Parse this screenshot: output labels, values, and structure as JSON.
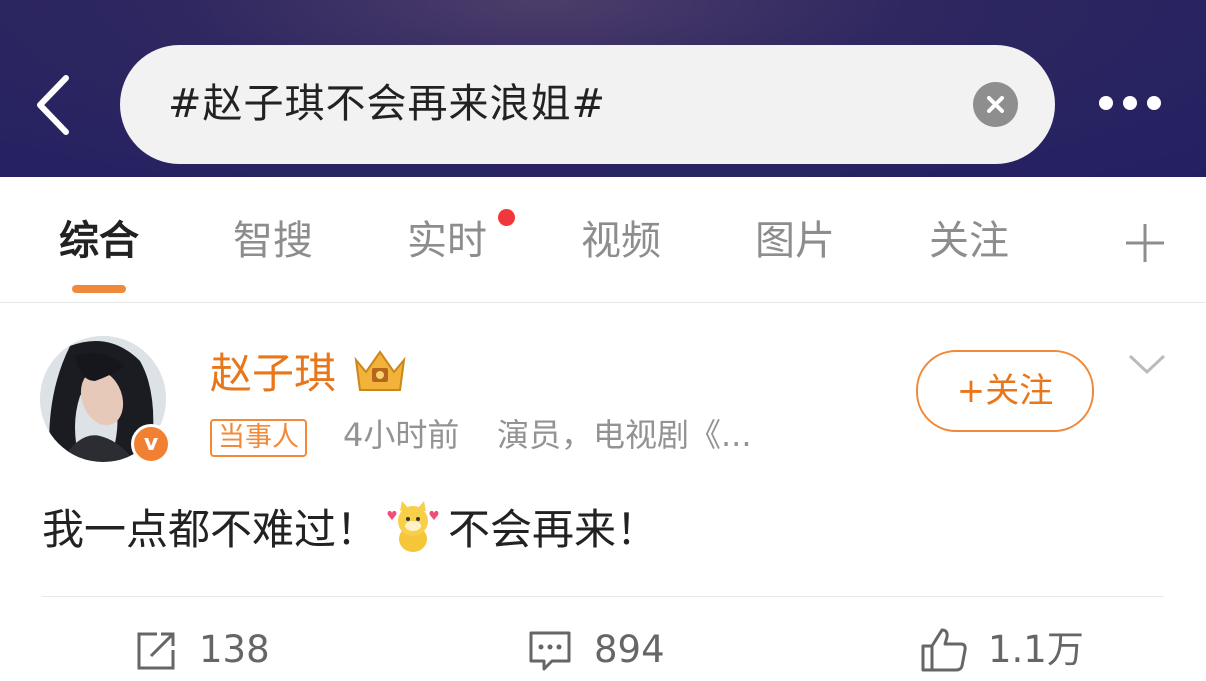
{
  "search": {
    "query": "#赵子琪不会再来浪姐#"
  },
  "tabs": [
    {
      "label": "综合",
      "active": true
    },
    {
      "label": "智搜"
    },
    {
      "label": "实时",
      "has_notification_dot": true
    },
    {
      "label": "视频"
    },
    {
      "label": "图片"
    },
    {
      "label": "关注"
    }
  ],
  "post": {
    "author": "赵子琪",
    "badge": "当事人",
    "time": "4小时前",
    "bio": "演员，电视剧《...",
    "follow_label": "+关注",
    "verified_icon": "v",
    "content_before": "我一点都不难过！",
    "content_after": "不会再来！",
    "emoji_icon": "cheering-dog-emoji"
  },
  "actions": {
    "repost": "138",
    "comment": "894",
    "like": "1.1万"
  },
  "colors": {
    "header_bg": "#2a2462",
    "accent": "#e8771b",
    "notification_dot": "#f0383c"
  }
}
